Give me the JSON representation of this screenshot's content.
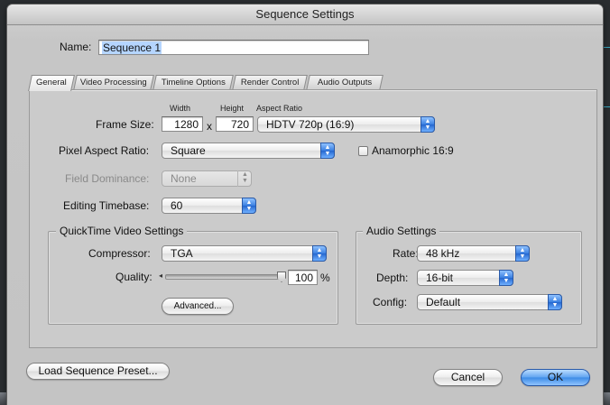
{
  "window": {
    "title": "Sequence Settings"
  },
  "name_field": {
    "label": "Name:",
    "value": "Sequence 1"
  },
  "tabs": [
    {
      "label": "General",
      "active": true
    },
    {
      "label": "Video Processing",
      "active": false
    },
    {
      "label": "Timeline Options",
      "active": false
    },
    {
      "label": "Render Control",
      "active": false
    },
    {
      "label": "Audio Outputs",
      "active": false
    }
  ],
  "general": {
    "frame_size": {
      "label": "Frame Size:",
      "width_header": "Width",
      "height_header": "Height",
      "aspect_header": "Aspect Ratio",
      "width": "1280",
      "separator": "x",
      "height": "720",
      "aspect_ratio": "HDTV 720p (16:9)"
    },
    "pixel_aspect": {
      "label": "Pixel Aspect Ratio:",
      "value": "Square"
    },
    "anamorphic": {
      "label": "Anamorphic 16:9",
      "checked": false
    },
    "field_dominance": {
      "label": "Field Dominance:",
      "value": "None",
      "enabled": false
    },
    "editing_timebase": {
      "label": "Editing Timebase:",
      "value": "60"
    }
  },
  "quicktime": {
    "title": "QuickTime Video Settings",
    "compressor_label": "Compressor:",
    "compressor": "TGA",
    "quality_label": "Quality:",
    "quality_value": "100",
    "quality_unit": "%",
    "quality_fraction": 1.0,
    "advanced_label": "Advanced..."
  },
  "audio": {
    "title": "Audio Settings",
    "rate_label": "Rate:",
    "rate": "48 kHz",
    "depth_label": "Depth:",
    "depth": "16-bit",
    "config_label": "Config:",
    "config": "Default"
  },
  "buttons": {
    "load_preset": "Load Sequence Preset...",
    "cancel": "Cancel",
    "ok": "OK"
  },
  "icons": {
    "popup_arrows": "updown-arrows-icon",
    "slider_left": "slider-left-arrow-icon"
  },
  "colors": {
    "accent": "#3c8ae6",
    "selection": "#b5d5ff",
    "desktop_line": "#3aa8c0"
  }
}
